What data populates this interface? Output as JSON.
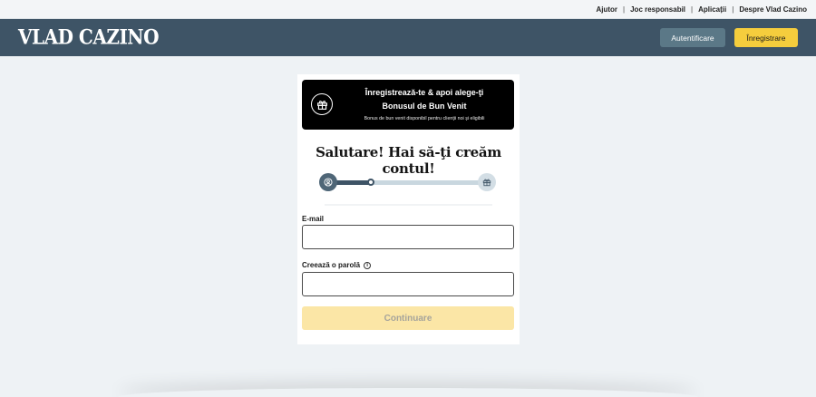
{
  "topnav": {
    "links": [
      "Ajutor",
      "Joc responsabil",
      "Aplicații",
      "Despre Vlad Cazino"
    ],
    "separator": "|"
  },
  "header": {
    "logo_text": "VLAD CAZINO",
    "login_label": "Autentificare",
    "register_label": "Înregistrare",
    "colors": {
      "header_bg": "#3e5466",
      "login_bg": "#5b7887",
      "register_bg": "#f5cd3d"
    }
  },
  "promo": {
    "icon": "gift-icon",
    "line1": "Înregistrează-te & apoi alege-ţi",
    "line2": "Bonusul de Bun Venit",
    "note": "Bonus de bun venit disponibil pentru clienţii noi şi eligibili"
  },
  "form": {
    "greeting": "Salutare! Hai să-ţi creăm contul!",
    "progress": {
      "current_step": 1,
      "total_steps": 3,
      "step1_icon": "user-icon",
      "step3_icon": "gift-icon"
    },
    "email_label": "E-mail",
    "email_value": "",
    "password_label": "Creează o parolă",
    "password_info_icon": "info-icon",
    "password_value": "",
    "continue_label": "Continuare",
    "continue_disabled": true
  }
}
